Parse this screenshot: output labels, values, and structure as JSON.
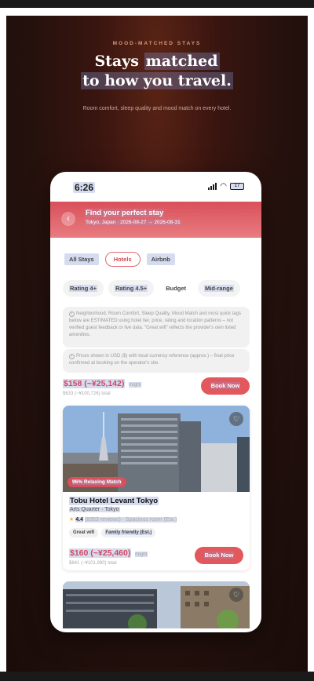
{
  "poster": {
    "kicker": "MOOD-MATCHED STAYS",
    "headline_part1": "Stays ",
    "headline_highlight1": "matched",
    "headline_line2": "to how you travel.",
    "subhead": "Room comfort, sleep quality and mood match on every hotel."
  },
  "status": {
    "time": "6:26",
    "battery": "17"
  },
  "header": {
    "title": "Find your perfect stay",
    "subtitle": "Tokyo, Japan · 2026-08-27 → 2026-08-31"
  },
  "category_filters": [
    "All Stays",
    "Hotels",
    "Airbnb"
  ],
  "selected_category": "Hotels",
  "rating_filters": [
    "Rating 4+",
    "Rating 4.5+",
    "Budget",
    "Mid-range"
  ],
  "notices": {
    "estimate": "Neighborhood, Room Comfort, Sleep Quality, Mood Match and most quick tags below are ESTIMATED using hotel tier, price, rating and location patterns – not verified guest feedback or live data. \"Great wifi\" reflects the provider's own listed amenities.",
    "currency": "Prices shown in USD ($) with local currency reference (approx.) – final price confirmed at booking on the operator's site."
  },
  "first_result": {
    "price": "$158 (~¥25,142)",
    "per": "/night",
    "total": "$633 (~¥100,726) total",
    "book_label": "Book Now"
  },
  "hotel_card": {
    "mood_badge": "96% Relaxing Match",
    "name": "Tobu Hotel Levant Tokyo",
    "area": "Arts Quarter · Tokyo",
    "rating": "4.4",
    "reviews": "(8353 reviews) · Spacious room (Est.)",
    "tags": [
      "Great wifi",
      "Family friendly (Est.)"
    ],
    "price": "$160 (~¥25,460)",
    "per": "/night",
    "total": "$641 (~¥101,990) total",
    "book_label": "Book Now"
  },
  "colors": {
    "accent": "#e2585c",
    "header": "#d9505a",
    "poster_bg": "#24110d"
  },
  "icons": [
    "back-arrow-icon",
    "heart-icon",
    "star-icon",
    "info-icon",
    "wifi-icon",
    "signal-icon",
    "battery-icon",
    "mood-heart-icon"
  ]
}
